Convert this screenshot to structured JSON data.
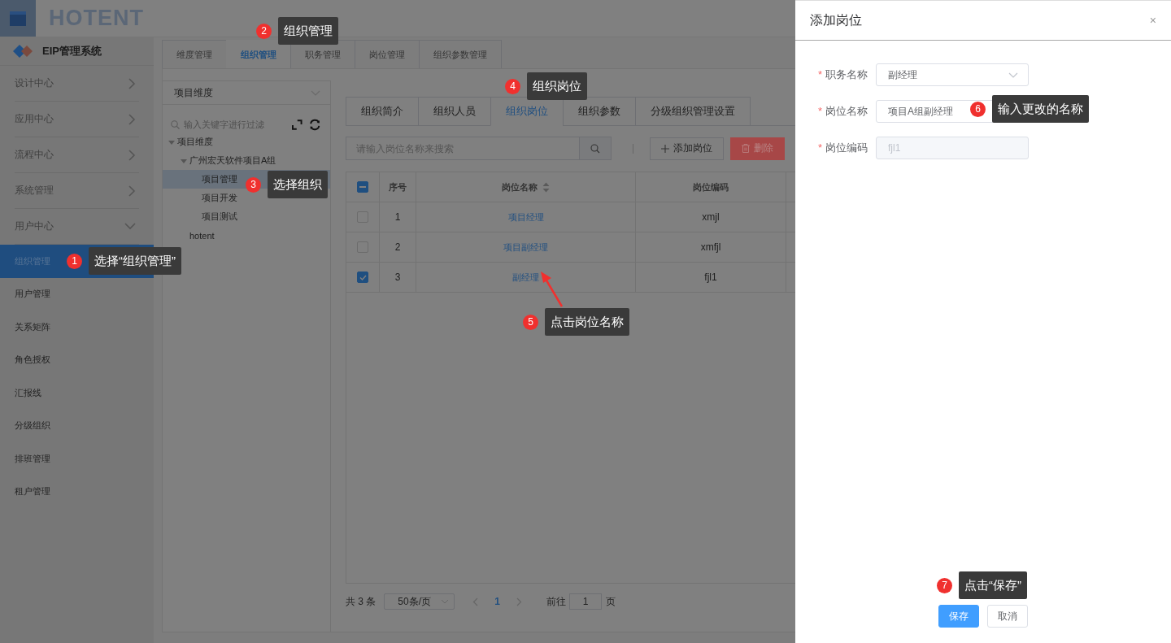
{
  "header": {
    "logo": "HOTENT"
  },
  "sidebar": {
    "title": "EIP管理系统",
    "groups": [
      {
        "label": "设计中心",
        "expanded": false
      },
      {
        "label": "应用中心",
        "expanded": false
      },
      {
        "label": "流程中心",
        "expanded": false
      },
      {
        "label": "系统管理",
        "expanded": false
      },
      {
        "label": "用户中心",
        "expanded": true
      }
    ],
    "items": [
      {
        "label": "组织管理",
        "selected": true
      },
      {
        "label": "用户管理",
        "selected": false
      },
      {
        "label": "关系矩阵",
        "selected": false
      },
      {
        "label": "角色授权",
        "selected": false
      },
      {
        "label": "汇报线",
        "selected": false
      },
      {
        "label": "分级组织",
        "selected": false
      },
      {
        "label": "排班管理",
        "selected": false
      },
      {
        "label": "租户管理",
        "selected": false
      }
    ]
  },
  "top_tabs": [
    {
      "label": "维度管理",
      "selected": false
    },
    {
      "label": "组织管理",
      "selected": true
    },
    {
      "label": "职务管理",
      "selected": false
    },
    {
      "label": "岗位管理",
      "selected": false
    },
    {
      "label": "组织参数管理",
      "selected": false
    }
  ],
  "tree_panel": {
    "dimension": "项目维度",
    "filter_placeholder": "输入关键字进行过滤",
    "tree": [
      {
        "label": "项目维度",
        "selected": false,
        "expanded": true,
        "children": [
          {
            "label": "广州宏天软件项目A组",
            "selected": false,
            "expanded": true,
            "children": [
              {
                "label": "项目管理",
                "selected": true
              },
              {
                "label": "项目开发",
                "selected": false
              },
              {
                "label": "项目测试",
                "selected": false
              }
            ]
          },
          {
            "label": "hotent",
            "selected": false
          }
        ]
      }
    ]
  },
  "org_tabs": [
    {
      "label": "组织简介",
      "selected": false
    },
    {
      "label": "组织人员",
      "selected": false
    },
    {
      "label": "组织岗位",
      "selected": true
    },
    {
      "label": "组织参数",
      "selected": false
    },
    {
      "label": "分级组织管理设置",
      "selected": false
    }
  ],
  "search": {
    "placeholder": "请输入岗位名称来搜索"
  },
  "toolbar": [
    {
      "kind": "add",
      "label": "添加岗位"
    },
    {
      "kind": "delete",
      "label": "删除"
    }
  ],
  "table": {
    "header_checkbox": {
      "indeterminate": true
    },
    "columns": [
      "序号",
      "岗位名称",
      "岗位编码"
    ],
    "rows": [
      {
        "checked": false,
        "index": "1",
        "name": "项目经理",
        "code": "xmjl"
      },
      {
        "checked": false,
        "index": "2",
        "name": "项目副经理",
        "code": "xmfjl"
      },
      {
        "checked": true,
        "index": "3",
        "name": "副经理",
        "code": "fjl1"
      }
    ]
  },
  "pagination": {
    "total": "共 3 条",
    "page_size": "50条/页",
    "pages": [
      {
        "label": "1",
        "selected": true
      }
    ],
    "goto_label": "前往",
    "goto_value": "1",
    "goto_unit": "页"
  },
  "drawer": {
    "title": "添加岗位",
    "close": "×",
    "fields": [
      {
        "kind": "select",
        "required_mark": "*",
        "label": "职务名称",
        "value": "副经理",
        "disabled": false
      },
      {
        "kind": "input",
        "required_mark": "*",
        "label": "岗位名称",
        "value": "项目A组副经理",
        "disabled": false
      },
      {
        "kind": "input",
        "required_mark": "*",
        "label": "岗位编码",
        "value": "fjl1",
        "disabled": true
      }
    ],
    "buttons": [
      {
        "kind": "primary",
        "label": "保存"
      },
      {
        "kind": "default",
        "label": "取消"
      }
    ]
  },
  "annotations": [
    {
      "number": "1",
      "text": "选择“组织管理”"
    },
    {
      "number": "2",
      "text": "组织管理"
    },
    {
      "number": "3",
      "text": "选择组织"
    },
    {
      "number": "4",
      "text": "组织岗位"
    },
    {
      "number": "5",
      "text": "点击岗位名称"
    },
    {
      "number": "6",
      "text": "输入更改的名称"
    },
    {
      "number": "7",
      "text": "点击“保存”"
    }
  ]
}
